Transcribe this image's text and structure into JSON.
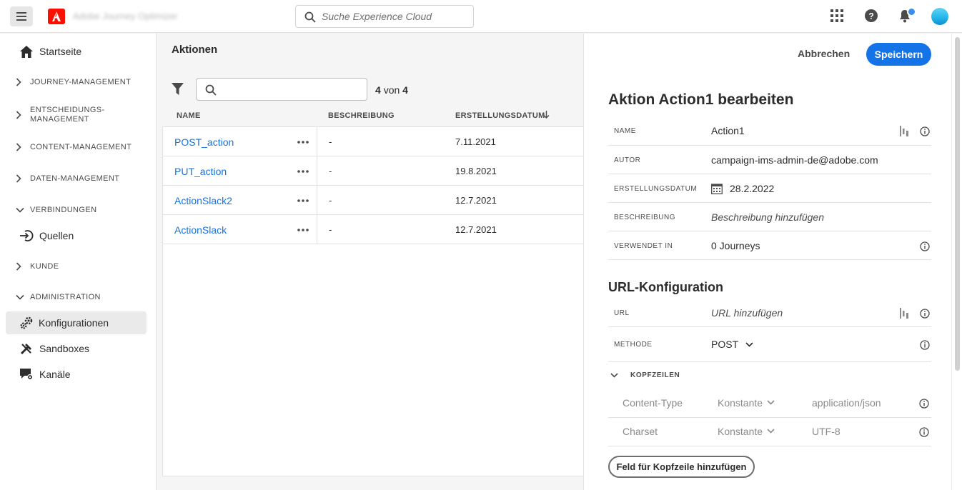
{
  "topbar": {
    "app_title": "Adobe Journey Optimizer",
    "search_placeholder": "Suche Experience Cloud"
  },
  "sidebar": {
    "home": "Startseite",
    "sections": {
      "journey": "JOURNEY-MANAGEMENT",
      "decision_1": "ENTSCHEIDUNGS-",
      "decision_2": "MANAGEMENT",
      "content": "CONTENT-MANAGEMENT",
      "data": "DATEN-MANAGEMENT",
      "connections": "VERBINDUNGEN",
      "customer": "KUNDE",
      "admin": "ADMINISTRATION"
    },
    "sources": "Quellen",
    "configurations": "Konfigurationen",
    "sandboxes": "Sandboxes",
    "channels": "Kanäle"
  },
  "list": {
    "title": "Aktionen",
    "count_shown": "4",
    "count_of": "von",
    "count_total": "4",
    "columns": {
      "name": "NAME",
      "description": "BESCHREIBUNG",
      "created": "ERSTELLUNGSDATUM"
    },
    "rows": [
      {
        "name": "POST_action",
        "description": "-",
        "date": "7.11.2021"
      },
      {
        "name": "PUT_action",
        "description": "-",
        "date": "19.8.2021"
      },
      {
        "name": "ActionSlack2",
        "description": "-",
        "date": "12.7.2021"
      },
      {
        "name": "ActionSlack",
        "description": "-",
        "date": "12.7.2021"
      }
    ]
  },
  "panel": {
    "cancel": "Abbrechen",
    "save": "Speichern",
    "title": "Aktion Action1 bearbeiten",
    "fields": {
      "name_label": "NAME",
      "name_value": "Action1",
      "author_label": "AUTOR",
      "author_value": "campaign-ims-admin-de@adobe.com",
      "created_label": "ERSTELLUNGSDATUM",
      "created_value": "28.2.2022",
      "desc_label": "BESCHREIBUNG",
      "desc_placeholder": "Beschreibung hinzufügen",
      "used_label": "VERWENDET IN",
      "used_value": "0 Journeys"
    },
    "url_section": "URL-Konfiguration",
    "url_label": "URL",
    "url_placeholder": "URL hinzufügen",
    "method_label": "METHODE",
    "method_value": "POST",
    "headers_title": "KOPFZEILEN",
    "headers": [
      {
        "name": "Content-Type",
        "type": "Konstante",
        "value": "application/json"
      },
      {
        "name": "Charset",
        "type": "Konstante",
        "value": "UTF-8"
      }
    ],
    "add_header": "Feld für Kopfzeile hinzufügen"
  },
  "colors": {
    "accent": "#1473e6",
    "brand": "#fa0f00"
  }
}
